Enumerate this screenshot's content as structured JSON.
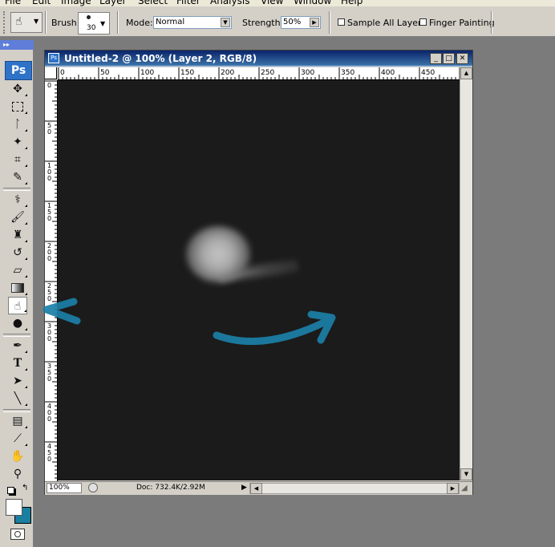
{
  "menu": {
    "items": [
      {
        "label": "File",
        "underline": "F",
        "rest": "ile"
      },
      {
        "label": "Edit",
        "underline": "E",
        "rest": "dit"
      },
      {
        "label": "Image",
        "underline": "I",
        "rest": "mage"
      },
      {
        "label": "Layer",
        "underline": "L",
        "rest": "ayer"
      },
      {
        "label": "Select",
        "underline": "S",
        "rest": "elect"
      },
      {
        "label": "Filter",
        "underline": "T",
        "rest": "ilter",
        "prefix": "Fil",
        "after": "er"
      },
      {
        "label": "Analysis",
        "underline": "A",
        "rest": "nalysis"
      },
      {
        "label": "View",
        "underline": "V",
        "rest": "iew"
      },
      {
        "label": "Window",
        "underline": "W",
        "rest": "indow"
      },
      {
        "label": "Help",
        "underline": "H",
        "rest": "elp"
      }
    ]
  },
  "options": {
    "brush_label": "Brush:",
    "brush_size": "30",
    "mode_label": "Mode:",
    "mode_value": "Normal",
    "strength_label": "Strength:",
    "strength_value": "50%",
    "sample_all_layers": {
      "label": "Sample All Layers",
      "checked": false
    },
    "finger_painting": {
      "label": "Finger Painting",
      "checked": false
    }
  },
  "toolbox": {
    "logo": "Ps",
    "active_tool": "smudge-tool",
    "foreground_color": "#ffffff",
    "background_color": "#1a7fa0"
  },
  "document": {
    "title": "Untitled-2 @ 100% (Layer 2, RGB/8)",
    "icon_text": "Ps",
    "ruler_top": [
      "0",
      "50",
      "100",
      "150",
      "200",
      "250",
      "300",
      "350",
      "400",
      "450"
    ],
    "ruler_left": [
      "0",
      "5\n0",
      "1\n0\n0",
      "1\n5\n0",
      "2\n0\n0",
      "2\n5\n0",
      "3\n0\n0",
      "3\n5\n0",
      "4\n0\n0",
      "4\n5\n0"
    ],
    "zoom": "100%",
    "doc_size": "Doc: 732.4K/2.92M",
    "canvas_color": "#1b1b1b"
  },
  "annotations": {
    "arrow_color": "#1b7fa6"
  }
}
